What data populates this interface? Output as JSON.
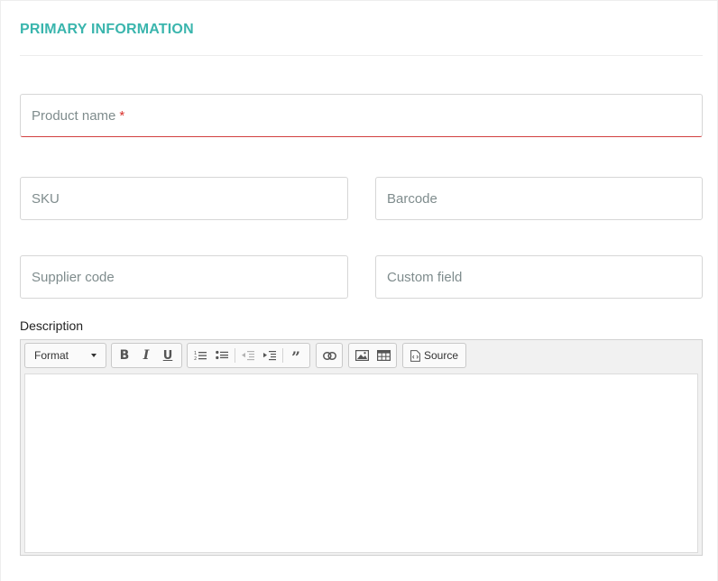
{
  "section": {
    "title": "PRIMARY INFORMATION"
  },
  "fields": {
    "product_name": {
      "placeholder": "Product name",
      "required_mark": "*",
      "value": ""
    },
    "sku": {
      "placeholder": "SKU",
      "value": ""
    },
    "barcode": {
      "placeholder": "Barcode",
      "value": ""
    },
    "supplier_code": {
      "placeholder": "Supplier code",
      "value": ""
    },
    "custom_field": {
      "placeholder": "Custom field",
      "value": ""
    }
  },
  "description": {
    "label": "Description",
    "toolbar": {
      "format_label": "Format",
      "source_label": "Source",
      "buttons": [
        "bold",
        "italic",
        "underline",
        "numbered-list",
        "bulleted-list",
        "decrease-indent",
        "increase-indent",
        "blockquote",
        "link",
        "image",
        "table",
        "source"
      ]
    },
    "content": ""
  },
  "colors": {
    "accent": "#3ab5ad",
    "required": "#d9302c",
    "error_border": "#d24040"
  }
}
